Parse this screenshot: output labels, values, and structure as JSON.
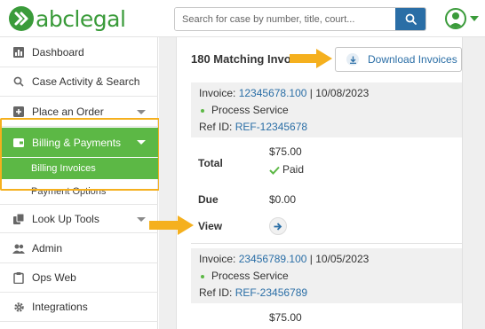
{
  "header": {
    "logo_text": "abclegal",
    "search_placeholder": "Search for case by number, title, court...",
    "search_icon": "search-icon",
    "avatar_icon": "user-avatar-icon"
  },
  "sidebar": {
    "items": [
      {
        "label": "Dashboard",
        "icon": "dashboard-icon"
      },
      {
        "label": "Case Activity & Search",
        "icon": "search-icon"
      },
      {
        "label": "Place an Order",
        "icon": "plus-square-icon"
      },
      {
        "label": "Billing & Payments",
        "icon": "wallet-icon"
      },
      {
        "label": "Look Up Tools",
        "icon": "copy-icon"
      },
      {
        "label": "Admin",
        "icon": "users-icon"
      },
      {
        "label": "Ops Web",
        "icon": "clipboard-icon"
      },
      {
        "label": "Integrations",
        "icon": "gear-icon"
      }
    ],
    "sub_items": [
      {
        "label": "Billing Invoices"
      },
      {
        "label": "Payment Options"
      }
    ]
  },
  "main": {
    "match_title": "180 Matching Invoices",
    "download_label": "Download Invoices",
    "invoices": [
      {
        "invoice_label": "Invoice: ",
        "invoice_number": "12345678.100",
        "separator": " | ",
        "date": "10/08/2023",
        "service": "Process Service",
        "ref_label": "Ref ID: ",
        "ref_id": "REF-12345678",
        "total_label": "Total",
        "total": "$75.00",
        "status": "Paid",
        "due_label": "Due",
        "due": "$0.00",
        "view_label": "View"
      },
      {
        "invoice_label": "Invoice: ",
        "invoice_number": "23456789.100",
        "separator": " | ",
        "date": "10/05/2023",
        "service": "Process Service",
        "ref_label": "Ref ID: ",
        "ref_id": "REF-23456789",
        "total": "$75.00"
      }
    ]
  },
  "colors": {
    "brand_green": "#3a9b3a",
    "active_green": "#5cb845",
    "link_blue": "#2a6ea6",
    "highlight_orange": "#f5b01e"
  }
}
